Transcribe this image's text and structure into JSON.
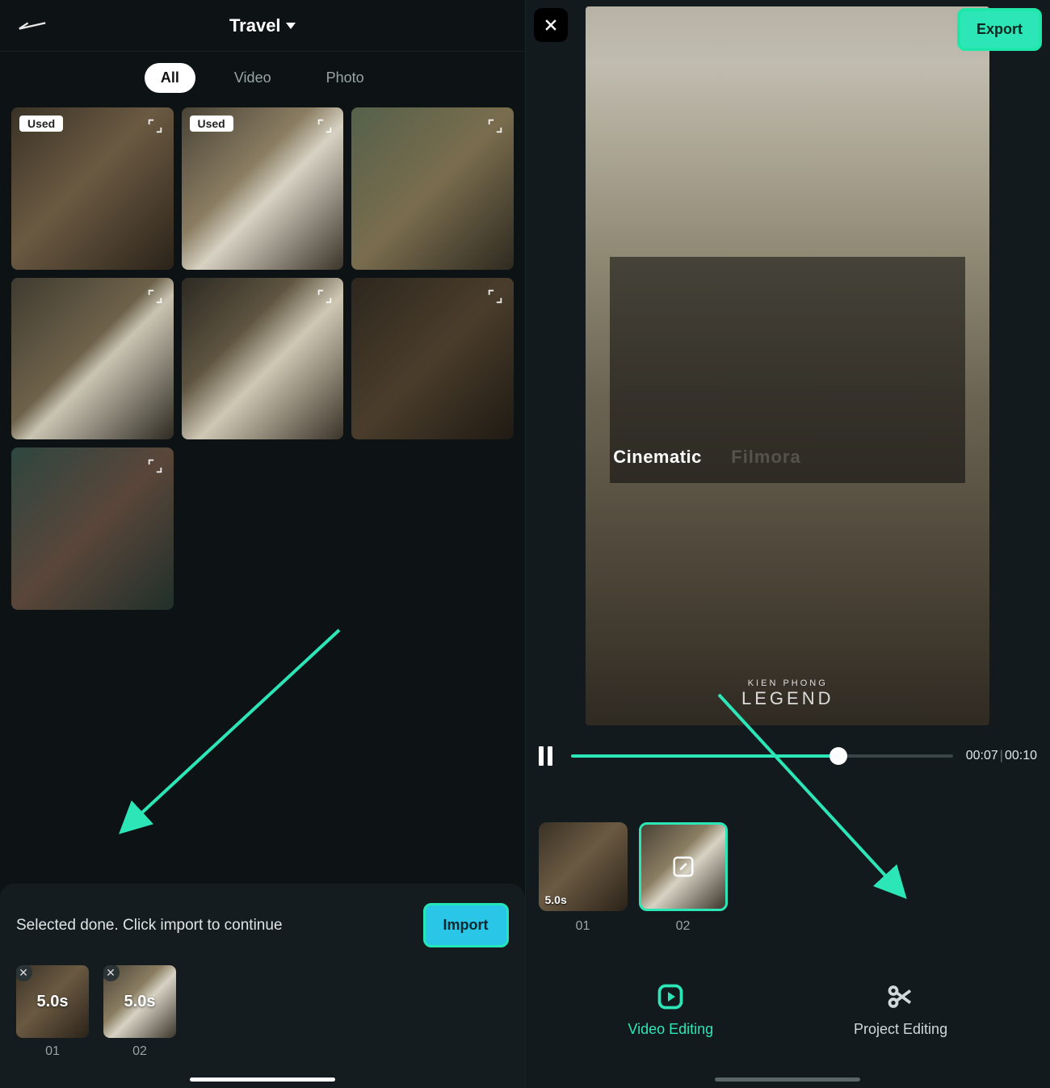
{
  "left": {
    "album_title": "Travel",
    "tabs": {
      "all": "All",
      "video": "Video",
      "photo": "Photo"
    },
    "used_label": "Used",
    "grid": [
      {
        "used": true
      },
      {
        "used": true
      },
      {
        "used": false
      },
      {
        "used": false
      },
      {
        "used": false
      },
      {
        "used": false
      },
      {
        "used": false
      }
    ],
    "selection_hint": "Selected done. Click import to continue",
    "import_label": "Import",
    "selected": [
      {
        "duration": "5.0s",
        "label": "01"
      },
      {
        "duration": "5.0s",
        "label": "02"
      }
    ]
  },
  "right": {
    "export_label": "Export",
    "overlay": {
      "cinematic": "Cinematic",
      "filmora": "Filmora",
      "legend_small": "KIEN PHONG",
      "legend_big": "LEGEND"
    },
    "time": {
      "current": "00:07",
      "total": "00:10"
    },
    "clips": [
      {
        "duration": "5.0s",
        "label": "01",
        "selected": false
      },
      {
        "duration": "",
        "label": "02",
        "selected": true
      }
    ],
    "actions": {
      "video_editing": "Video Editing",
      "project_editing": "Project Editing"
    }
  },
  "colors": {
    "accent": "#2de6b8",
    "import": "#29c6e8"
  }
}
